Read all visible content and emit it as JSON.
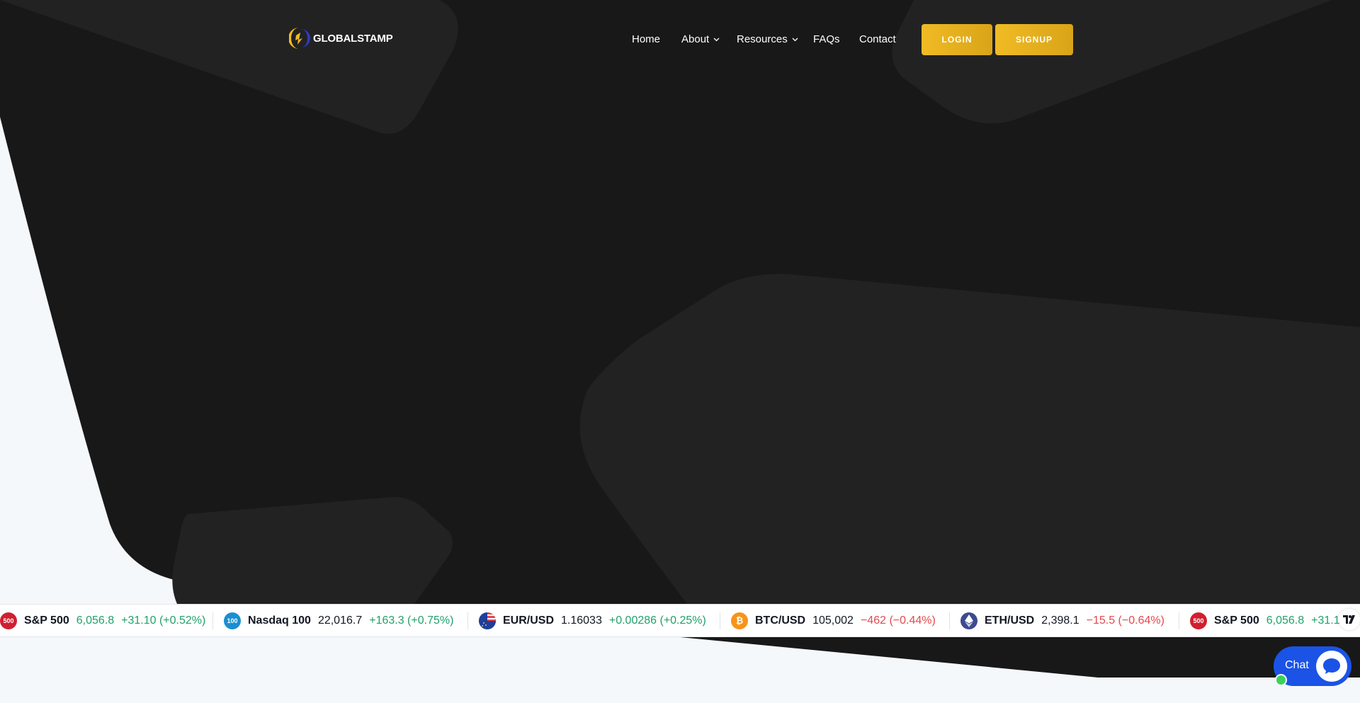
{
  "colors": {
    "hero_background": "#181818",
    "hero_shapes": "#222222",
    "page_background": "#f5f8fb",
    "accent_gold": "#f0bb24",
    "positive": "#22a06b",
    "negative": "#e5484d",
    "chat_blue": "#1a53e6"
  },
  "header": {
    "logo_text": "GLOBALSTAMP",
    "nav": [
      {
        "label": "Home",
        "has_dropdown": false
      },
      {
        "label": "About",
        "has_dropdown": true
      },
      {
        "label": "Resources",
        "has_dropdown": true
      },
      {
        "label": "FAQs",
        "has_dropdown": false
      },
      {
        "label": "Contact",
        "has_dropdown": false
      }
    ],
    "login_label": "LOGIN",
    "signup_label": "SIGNUP"
  },
  "ticker": {
    "items": [
      {
        "icon": "500",
        "symbol": "S&P 500",
        "price": "6,056.8",
        "change": "+31.10 (+0.52%)",
        "direction": "up"
      },
      {
        "icon": "100",
        "symbol": "Nasdaq 100",
        "price": "22,016.7",
        "change": "+163.3 (+0.75%)",
        "direction": "up"
      },
      {
        "icon": "eur-usd-flag-icon",
        "symbol": "EUR/USD",
        "price": "1.16033",
        "change": "+0.00286 (+0.25%)",
        "direction": "up"
      },
      {
        "icon": "bitcoin-icon",
        "symbol": "BTC/USD",
        "price": "105,002",
        "change": "−462 (−0.44%)",
        "direction": "down"
      },
      {
        "icon": "ethereum-icon",
        "symbol": "ETH/USD",
        "price": "2,398.1",
        "change": "−15.5 (−0.64%)",
        "direction": "down"
      },
      {
        "icon": "500",
        "symbol": "S&P 500",
        "price": "6,056.8",
        "change": "+31.1",
        "direction": "up"
      }
    ]
  },
  "chat": {
    "label": "Chat"
  }
}
